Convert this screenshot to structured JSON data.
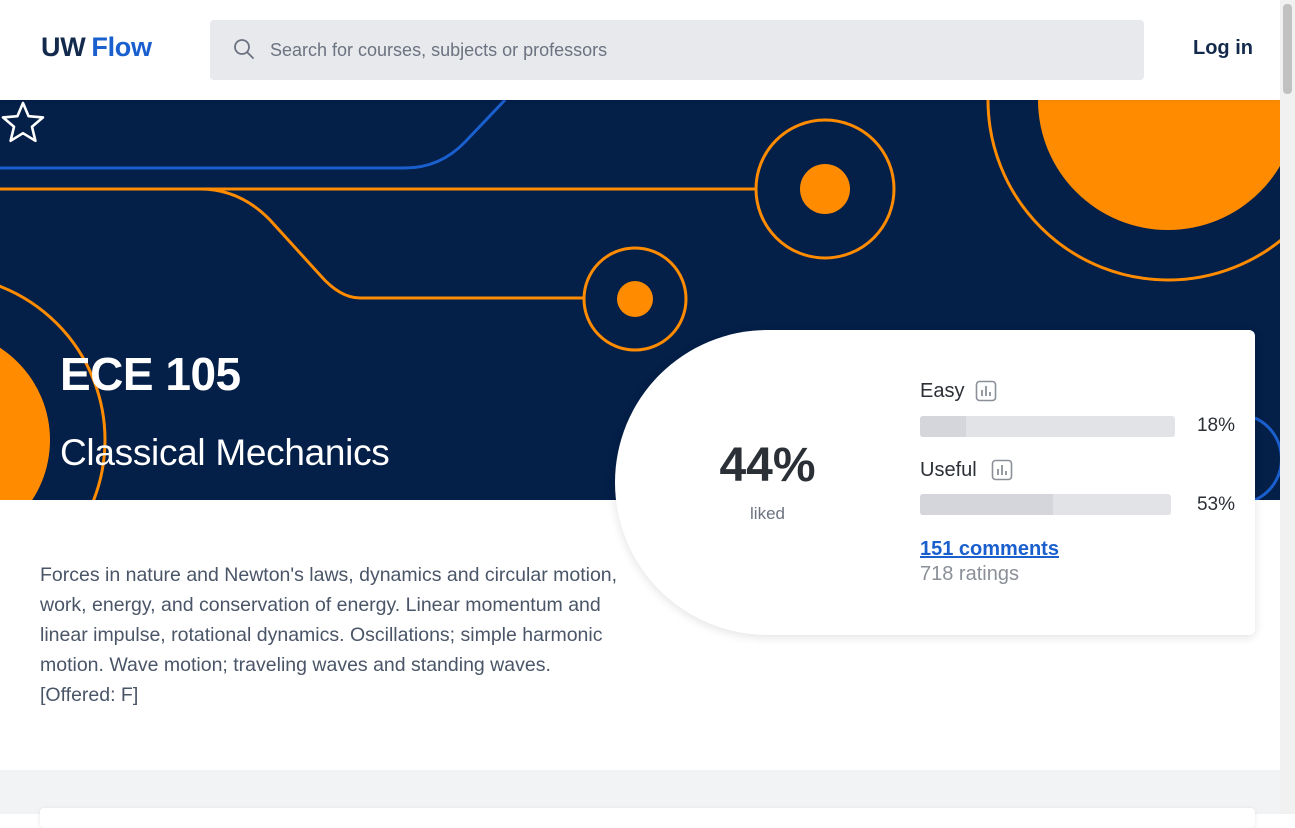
{
  "header": {
    "logo_uw": "UW",
    "logo_flow": "Flow",
    "search_placeholder": "Search for courses, subjects or professors",
    "login_label": "Log in"
  },
  "course": {
    "code": "ECE 105",
    "name": "Classical Mechanics",
    "description": "Forces in nature and Newton's laws, dynamics and circular motion, work, energy, and conservation of energy. Linear momentum and linear impulse, rotational dynamics. Oscillations; simple harmonic motion. Wave motion; traveling waves and standing waves. [Offered: F]"
  },
  "rating": {
    "liked_pct": "44%",
    "liked_label": "liked",
    "metrics": [
      {
        "label": "Easy",
        "value": "18%",
        "fraction": 0.18
      },
      {
        "label": "Useful",
        "value": "53%",
        "fraction": 0.53
      }
    ],
    "comments": "151 comments",
    "ratings": "718 ratings"
  },
  "colors": {
    "hero_bg": "#041f48",
    "accent_orange": "#ff8c00",
    "brand_blue": "#1a5fce",
    "brand_navy": "#132a4d"
  },
  "icons": [
    "search-icon",
    "star-icon",
    "bar-chart-icon"
  ]
}
